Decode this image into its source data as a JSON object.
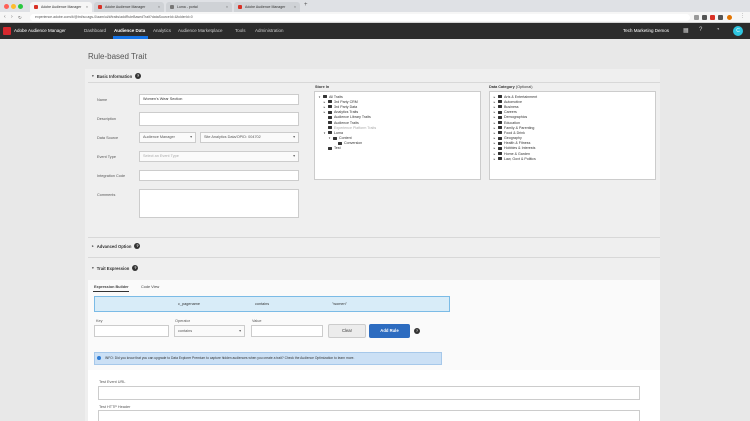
{
  "browser": {
    "tabs": [
      {
        "label": "Adobe Audience Manager"
      },
      {
        "label": "Adobe Audience Manager"
      },
      {
        "label": "Luma - portal"
      },
      {
        "label": "Adobe Audience Manager"
      }
    ],
    "url": "experience.adobe.com/#/@tnt/so:ags-0/aam/ui/#/traits/addRuleBasedTrait?dataSourceId=&folderId=0",
    "colors": {
      "close": "#ff5f57",
      "minimize": "#febc2e",
      "maximize": "#28c840"
    }
  },
  "app": {
    "name": "Adobe Audience Manager",
    "nav": [
      "Dashboard",
      "Audience Data",
      "Analytics",
      "Audience Marketplace",
      "Tools",
      "Administration"
    ],
    "active_nav": "Audience Data",
    "company": "Tech Marketing Demos",
    "avatar": "C",
    "accent": "#1473e6"
  },
  "page": {
    "title": "Rule-based Trait"
  },
  "basic_info": {
    "heading": "Basic Information",
    "fields": {
      "name_label": "Name",
      "name_value": "Women's Wear Section",
      "description_label": "Description",
      "data_source_label": "Data Source",
      "data_source_type": "Audience Manager",
      "data_source_value": "Site Analytics Data/OPID: 004702",
      "event_type_label": "Event Type",
      "event_type_placeholder": "Select an Event Type",
      "integration_code_label": "Integration Code",
      "comments_label": "Comments"
    }
  },
  "store_in": {
    "label": "Store In",
    "tree": [
      {
        "label": "All Traits",
        "level": 0,
        "toggle": "▾"
      },
      {
        "label": "3rd Party CRM",
        "level": 1,
        "toggle": "▸"
      },
      {
        "label": "3rd Party Data",
        "level": 1,
        "toggle": "▸"
      },
      {
        "label": "Analytics Traits",
        "level": 1,
        "toggle": "▸"
      },
      {
        "label": "Audience Library Traits",
        "level": 1,
        "toggle": ""
      },
      {
        "label": "Audience Traits",
        "level": 1,
        "toggle": ""
      },
      {
        "label": "Experience Platform Traits",
        "level": 1,
        "toggle": "",
        "dim": true
      },
      {
        "label": "Luma",
        "level": 1,
        "toggle": "▾"
      },
      {
        "label": "Content",
        "level": 2,
        "toggle": "▾"
      },
      {
        "label": "Conversion",
        "level": 3,
        "toggle": ""
      },
      {
        "label": "Test",
        "level": 1,
        "toggle": ""
      }
    ]
  },
  "data_category": {
    "label": "Data Category",
    "optional": "(Optional)",
    "items": [
      "Arts & Entertainment",
      "Automotive",
      "Business",
      "Careers",
      "Demographics",
      "Education",
      "Family & Parenting",
      "Food & Drink",
      "Geography",
      "Health & Fitness",
      "Hobbies & Interests",
      "Home & Garden",
      "Law, Govt & Politics"
    ]
  },
  "advanced": {
    "heading": "Advanced Option"
  },
  "trait_expression": {
    "heading": "Trait Expression",
    "tabs": [
      "Expression Builder",
      "Code View"
    ],
    "active_tab": "Expression Builder",
    "rule": {
      "key": "c_pagename",
      "operator": "contains",
      "value": "\"women\""
    },
    "key_label": "Key",
    "operator_label": "Operator",
    "operator_value": "contains",
    "value_label": "Value",
    "clear_label": "Clear",
    "add_rule_label": "Add Rule"
  },
  "info": {
    "text": "INFO: Did you know that you can upgrade to Data Explorer Premium to capture hidden audiences when you create a trait? Check the Audience Optimization to learn more."
  },
  "test": {
    "event_url_label": "Test Event URL",
    "http_header_label": "Test HTTP Header"
  }
}
